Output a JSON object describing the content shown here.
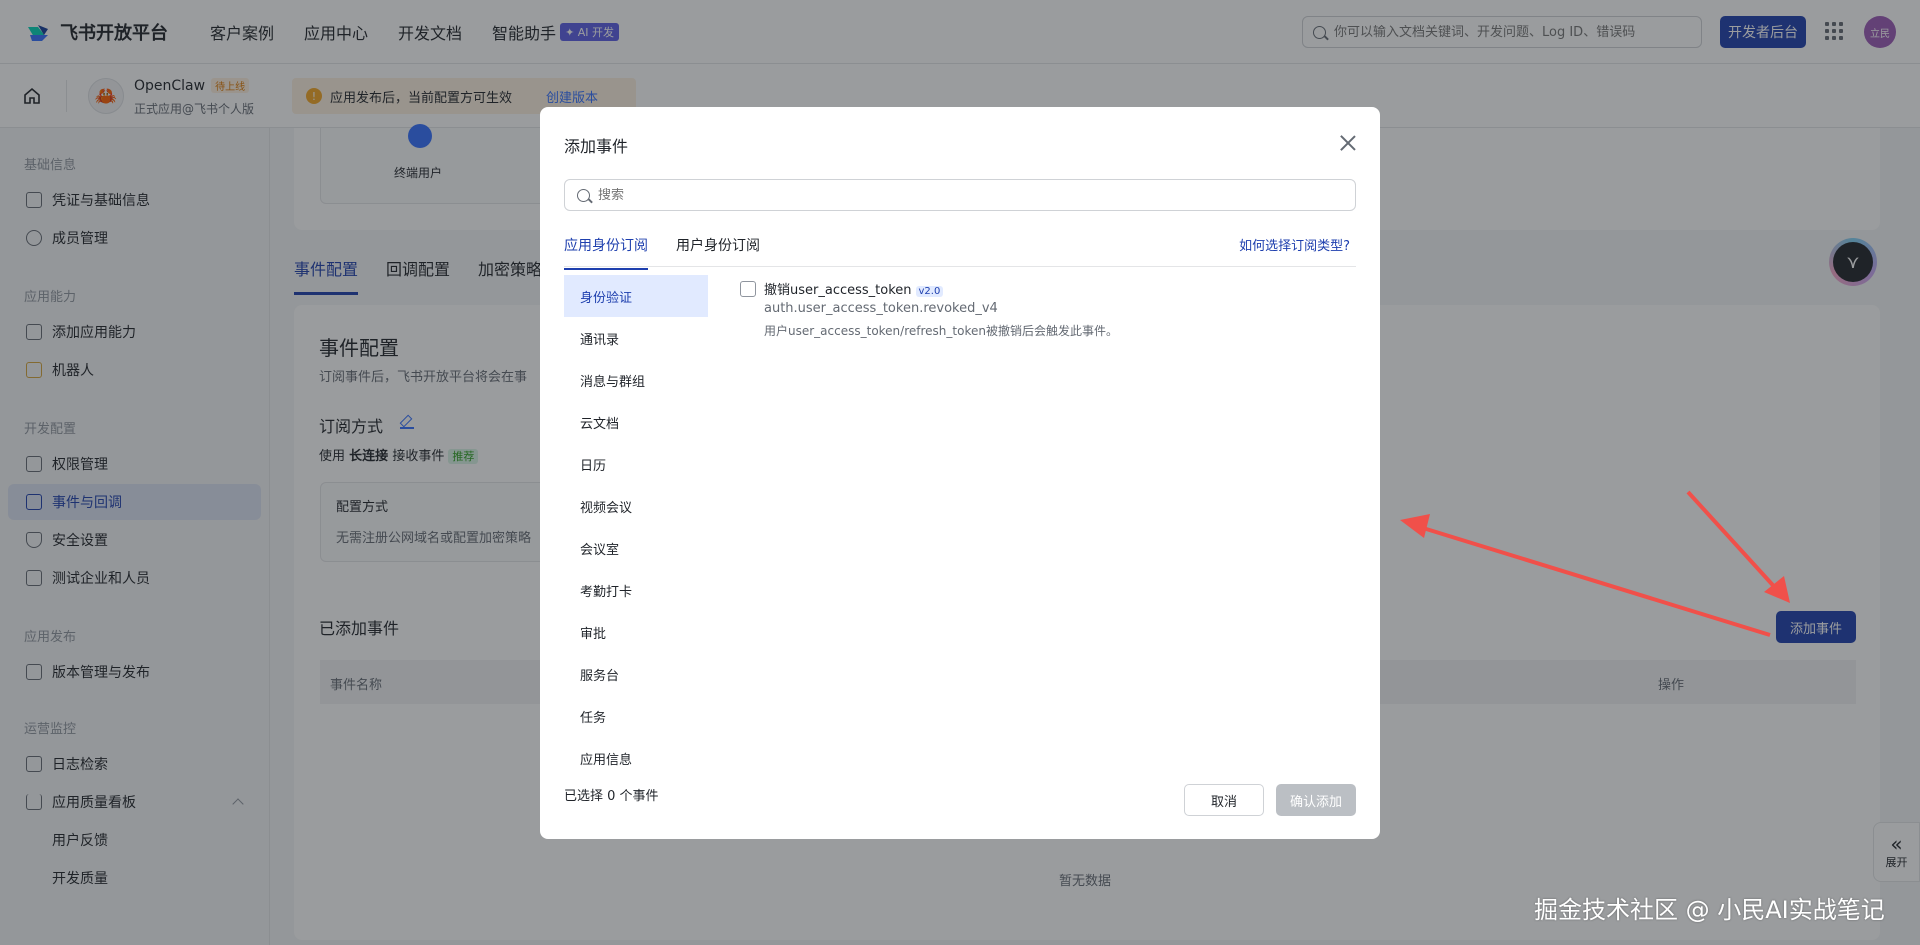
{
  "topnav": {
    "logo_text": "飞书开放平台",
    "links": [
      "客户案例",
      "应用中心",
      "开发文档",
      "智能助手"
    ],
    "ai_badge": "✦ AI 开发",
    "search_placeholder": "你可以输入文档关键词、开发问题、Log ID、错误码",
    "dev_console": "开发者后台",
    "avatar_text": "立民"
  },
  "appbar": {
    "app_name": "OpenClaw",
    "app_tag": "待上线",
    "app_sub": "正式应用@飞书个人版",
    "notice_text": "应用发布后，当前配置方可生效",
    "notice_link": "创建版本"
  },
  "sidebar": {
    "groups": [
      "基础信息",
      "应用能力",
      "开发配置",
      "应用发布",
      "运营监控"
    ],
    "items": [
      "凭证与基础信息",
      "成员管理",
      "添加应用能力",
      "机器人",
      "权限管理",
      "事件与回调",
      "安全设置",
      "测试企业和人员",
      "版本管理与发布",
      "日志检索",
      "应用质量看板"
    ],
    "sub_items": [
      "用户反馈",
      "开发质量"
    ]
  },
  "main": {
    "flow_user": "终端用户",
    "tabs": [
      "事件配置",
      "回调配置",
      "加密策略"
    ],
    "title": "事件配置",
    "desc": "订阅事件后，飞书开放平台将会在事",
    "subscribe_title": "订阅方式",
    "use_prefix": "使用",
    "use_bold": "长连接",
    "use_suffix": "接收事件",
    "rec_tag": "推荐",
    "cfg_title": "配置方式",
    "cfg_desc": "无需注册公网域名或配置加密策略",
    "added_title": "已添加事件",
    "th_name": "事件名称",
    "th_op": "操作",
    "empty": "暂无数据",
    "add_event": "添加事件",
    "expand": "展开"
  },
  "modal": {
    "title": "添加事件",
    "search_placeholder": "搜索",
    "tabs": [
      "应用身份订阅",
      "用户身份订阅"
    ],
    "help_link": "如何选择订阅类型?",
    "categories": [
      "身份验证",
      "通讯录",
      "消息与群组",
      "云文档",
      "日历",
      "视频会议",
      "会议室",
      "考勤打卡",
      "审批",
      "服务台",
      "任务",
      "应用信息"
    ],
    "event": {
      "name": "撤销user_access_token",
      "version": "v2.0",
      "key": "auth.user_access_token.revoked_v4",
      "desc": "用户user_access_token/refresh_token被撤销后会触发此事件。"
    },
    "selected_count": "已选择 0 个事件",
    "cancel": "取消",
    "confirm": "确认添加"
  },
  "watermark": "掘金技术社区 @ 小民AI实战笔记",
  "colors": {
    "accent": "#1e3fae",
    "arrow": "#f0504a",
    "link": "#3370ff"
  }
}
